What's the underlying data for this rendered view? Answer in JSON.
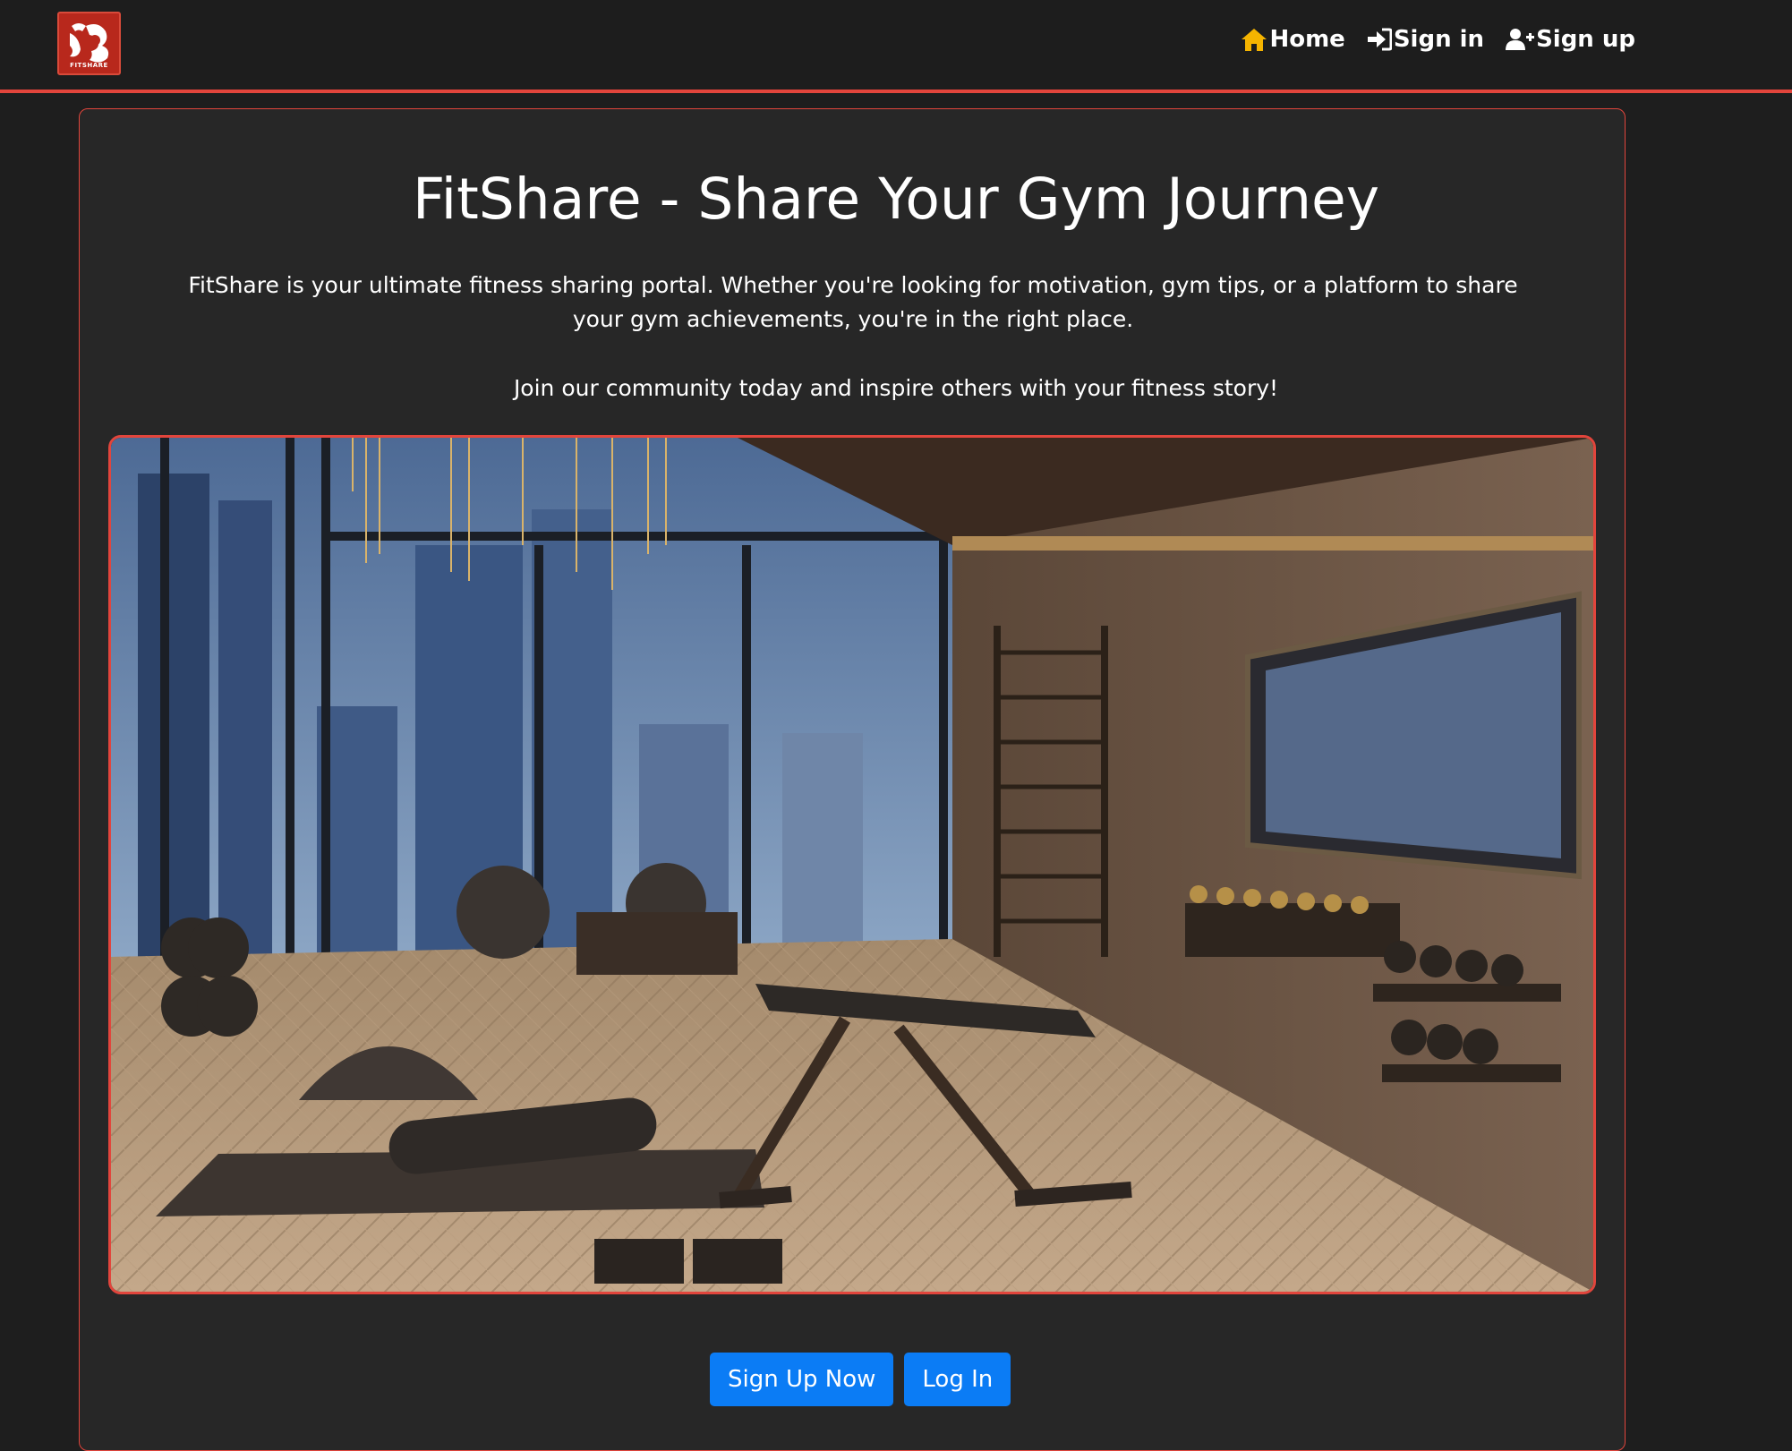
{
  "brand": {
    "logo_text": "FITSHARE",
    "logo_icon": "fitshare-logo-icon"
  },
  "nav": {
    "items": [
      {
        "label": "Home",
        "icon": "home-icon",
        "color": "#f5b400"
      },
      {
        "label": "Sign in",
        "icon": "sign-in-icon",
        "color": "#ffffff"
      },
      {
        "label": "Sign up",
        "icon": "user-plus-icon",
        "color": "#ffffff"
      }
    ]
  },
  "main": {
    "title": "FitShare - Share Your Gym Journey",
    "intro": "FitShare is your ultimate fitness sharing portal. Whether you're looking for motivation, gym tips, or a platform to share your gym achievements, you're in the right place.",
    "cta_text": "Join our community today and inspire others with your fitness story!",
    "hero_image": "luxury-home-gym-photo",
    "buttons": {
      "signup_label": "Sign Up Now",
      "login_label": "Log In"
    }
  },
  "colors": {
    "accent": "#e2453c",
    "button": "#0b7cf5",
    "background": "#1e1e1e",
    "card": "#272727"
  }
}
